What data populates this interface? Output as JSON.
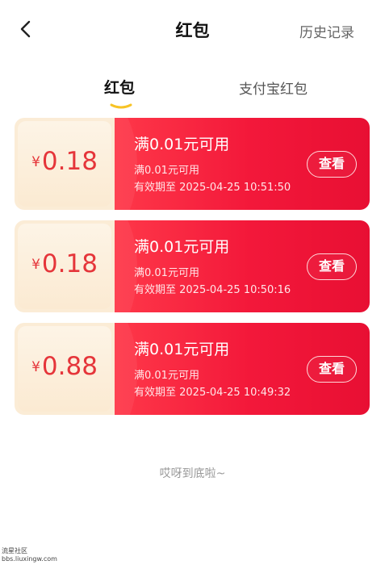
{
  "header": {
    "title": "红包",
    "history_label": "历史记录",
    "back_icon": "chevron-left-icon"
  },
  "tabs": [
    {
      "label": "红包",
      "active": true
    },
    {
      "label": "支付宝红包",
      "active": false
    }
  ],
  "colors": {
    "accent": "#f3183a",
    "tab_underline": "#f7c325",
    "amount": "#e5353a"
  },
  "coupons": [
    {
      "currency": "¥",
      "amount": "0.18",
      "title": "满0.01元可用",
      "condition": "满0.01元可用",
      "expiry": "有效期至 2025-04-25 10:51:50",
      "button_label": "查看"
    },
    {
      "currency": "¥",
      "amount": "0.18",
      "title": "满0.01元可用",
      "condition": "满0.01元可用",
      "expiry": "有效期至 2025-04-25 10:50:16",
      "button_label": "查看"
    },
    {
      "currency": "¥",
      "amount": "0.88",
      "title": "满0.01元可用",
      "condition": "满0.01元可用",
      "expiry": "有效期至 2025-04-25 10:49:32",
      "button_label": "查看"
    }
  ],
  "footer": {
    "end_text": "哎呀到底啦~"
  },
  "watermark": {
    "line1": "流星社区",
    "line2": "bbs.liuxingw.com"
  }
}
